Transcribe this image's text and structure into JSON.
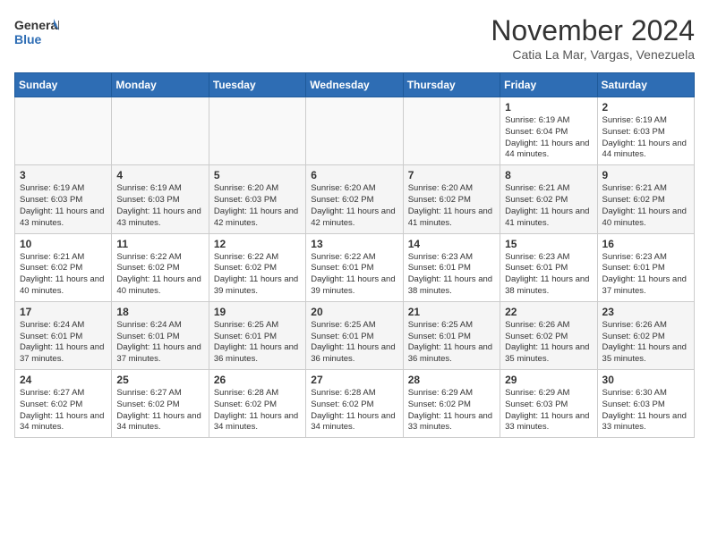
{
  "header": {
    "logo_general": "General",
    "logo_blue": "Blue",
    "month_title": "November 2024",
    "location": "Catia La Mar, Vargas, Venezuela"
  },
  "weekdays": [
    "Sunday",
    "Monday",
    "Tuesday",
    "Wednesday",
    "Thursday",
    "Friday",
    "Saturday"
  ],
  "weeks": [
    [
      {
        "day": "",
        "info": ""
      },
      {
        "day": "",
        "info": ""
      },
      {
        "day": "",
        "info": ""
      },
      {
        "day": "",
        "info": ""
      },
      {
        "day": "",
        "info": ""
      },
      {
        "day": "1",
        "info": "Sunrise: 6:19 AM\nSunset: 6:04 PM\nDaylight: 11 hours and 44 minutes."
      },
      {
        "day": "2",
        "info": "Sunrise: 6:19 AM\nSunset: 6:03 PM\nDaylight: 11 hours and 44 minutes."
      }
    ],
    [
      {
        "day": "3",
        "info": "Sunrise: 6:19 AM\nSunset: 6:03 PM\nDaylight: 11 hours and 43 minutes."
      },
      {
        "day": "4",
        "info": "Sunrise: 6:19 AM\nSunset: 6:03 PM\nDaylight: 11 hours and 43 minutes."
      },
      {
        "day": "5",
        "info": "Sunrise: 6:20 AM\nSunset: 6:03 PM\nDaylight: 11 hours and 42 minutes."
      },
      {
        "day": "6",
        "info": "Sunrise: 6:20 AM\nSunset: 6:02 PM\nDaylight: 11 hours and 42 minutes."
      },
      {
        "day": "7",
        "info": "Sunrise: 6:20 AM\nSunset: 6:02 PM\nDaylight: 11 hours and 41 minutes."
      },
      {
        "day": "8",
        "info": "Sunrise: 6:21 AM\nSunset: 6:02 PM\nDaylight: 11 hours and 41 minutes."
      },
      {
        "day": "9",
        "info": "Sunrise: 6:21 AM\nSunset: 6:02 PM\nDaylight: 11 hours and 40 minutes."
      }
    ],
    [
      {
        "day": "10",
        "info": "Sunrise: 6:21 AM\nSunset: 6:02 PM\nDaylight: 11 hours and 40 minutes."
      },
      {
        "day": "11",
        "info": "Sunrise: 6:22 AM\nSunset: 6:02 PM\nDaylight: 11 hours and 40 minutes."
      },
      {
        "day": "12",
        "info": "Sunrise: 6:22 AM\nSunset: 6:02 PM\nDaylight: 11 hours and 39 minutes."
      },
      {
        "day": "13",
        "info": "Sunrise: 6:22 AM\nSunset: 6:01 PM\nDaylight: 11 hours and 39 minutes."
      },
      {
        "day": "14",
        "info": "Sunrise: 6:23 AM\nSunset: 6:01 PM\nDaylight: 11 hours and 38 minutes."
      },
      {
        "day": "15",
        "info": "Sunrise: 6:23 AM\nSunset: 6:01 PM\nDaylight: 11 hours and 38 minutes."
      },
      {
        "day": "16",
        "info": "Sunrise: 6:23 AM\nSunset: 6:01 PM\nDaylight: 11 hours and 37 minutes."
      }
    ],
    [
      {
        "day": "17",
        "info": "Sunrise: 6:24 AM\nSunset: 6:01 PM\nDaylight: 11 hours and 37 minutes."
      },
      {
        "day": "18",
        "info": "Sunrise: 6:24 AM\nSunset: 6:01 PM\nDaylight: 11 hours and 37 minutes."
      },
      {
        "day": "19",
        "info": "Sunrise: 6:25 AM\nSunset: 6:01 PM\nDaylight: 11 hours and 36 minutes."
      },
      {
        "day": "20",
        "info": "Sunrise: 6:25 AM\nSunset: 6:01 PM\nDaylight: 11 hours and 36 minutes."
      },
      {
        "day": "21",
        "info": "Sunrise: 6:25 AM\nSunset: 6:01 PM\nDaylight: 11 hours and 36 minutes."
      },
      {
        "day": "22",
        "info": "Sunrise: 6:26 AM\nSunset: 6:02 PM\nDaylight: 11 hours and 35 minutes."
      },
      {
        "day": "23",
        "info": "Sunrise: 6:26 AM\nSunset: 6:02 PM\nDaylight: 11 hours and 35 minutes."
      }
    ],
    [
      {
        "day": "24",
        "info": "Sunrise: 6:27 AM\nSunset: 6:02 PM\nDaylight: 11 hours and 34 minutes."
      },
      {
        "day": "25",
        "info": "Sunrise: 6:27 AM\nSunset: 6:02 PM\nDaylight: 11 hours and 34 minutes."
      },
      {
        "day": "26",
        "info": "Sunrise: 6:28 AM\nSunset: 6:02 PM\nDaylight: 11 hours and 34 minutes."
      },
      {
        "day": "27",
        "info": "Sunrise: 6:28 AM\nSunset: 6:02 PM\nDaylight: 11 hours and 34 minutes."
      },
      {
        "day": "28",
        "info": "Sunrise: 6:29 AM\nSunset: 6:02 PM\nDaylight: 11 hours and 33 minutes."
      },
      {
        "day": "29",
        "info": "Sunrise: 6:29 AM\nSunset: 6:03 PM\nDaylight: 11 hours and 33 minutes."
      },
      {
        "day": "30",
        "info": "Sunrise: 6:30 AM\nSunset: 6:03 PM\nDaylight: 11 hours and 33 minutes."
      }
    ]
  ]
}
